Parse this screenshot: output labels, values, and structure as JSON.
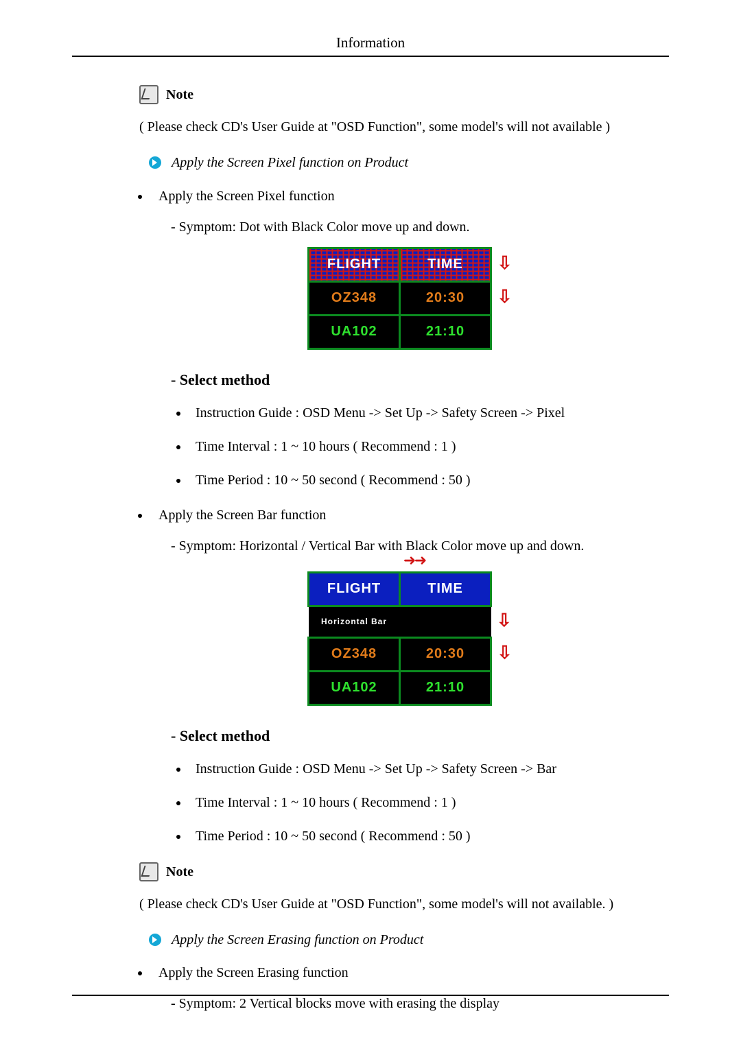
{
  "header": {
    "title": "Information"
  },
  "note_label": "Note",
  "note1_text": "( Please check CD's User Guide at \"OSD Function\", some model's will not available )",
  "arrow1_text": "Apply the Screen Pixel function on Product",
  "pixel_item": "Apply the Screen Pixel function",
  "pixel_symptom": "Symptom: Dot with Black Color move up and down.",
  "table1": {
    "h_left": "FLIGHT",
    "h_right": "TIME",
    "r1_left": "OZ348",
    "r1_right": "20:30",
    "r2_left": "UA102",
    "r2_right": "21:10"
  },
  "select_method_heading": "- Select method",
  "pixel_method": {
    "m1": "Instruction Guide : OSD Menu -> Set Up -> Safety Screen -> Pixel",
    "m2": "Time Interval : 1 ~ 10 hours ( Recommend : 1 )",
    "m3": "Time Period : 10 ~ 50 second ( Recommend : 50 )"
  },
  "bar_item": "Apply the Screen Bar function",
  "bar_symptom": "Symptom: Horizontal / Vertical Bar with Black Color move up and down.",
  "table2": {
    "h_left": "FLIGHT",
    "h_right": "TIME",
    "hbar_label": "Horizontal Bar",
    "r1_left": "OZ348",
    "r1_right": "20:30",
    "r2_left": "UA102",
    "r2_right": "21:10"
  },
  "bar_method": {
    "m1": "Instruction Guide : OSD Menu -> Set Up -> Safety Screen -> Bar",
    "m2": "Time Interval : 1 ~ 10 hours ( Recommend : 1 )",
    "m3": "Time Period : 10 ~ 50 second ( Recommend : 50 )"
  },
  "note2_text": "( Please check CD's User Guide at \"OSD Function\", some model's will not available. )",
  "arrow2_text": "Apply the Screen Erasing function on Product",
  "erase_item": "Apply the Screen Erasing function",
  "erase_symptom": "Symptom: 2 Vertical blocks move with erasing the display"
}
